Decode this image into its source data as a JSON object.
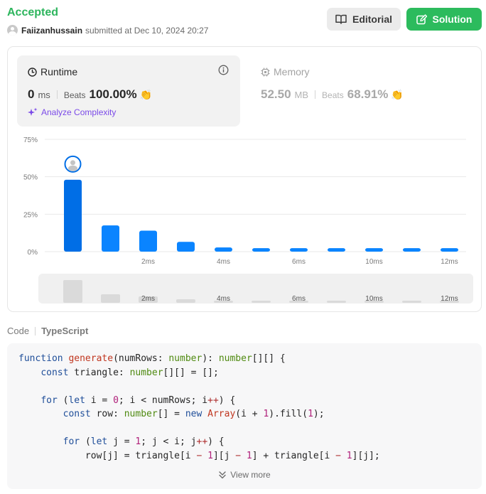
{
  "submission": {
    "status": "Accepted",
    "username": "Faiizanhussain",
    "submitted_text": "submitted at Dec 10, 2024 20:27"
  },
  "actions": {
    "editorial_label": "Editorial",
    "solution_label": "Solution"
  },
  "runtime": {
    "title": "Runtime",
    "value": "0",
    "unit": "ms",
    "beats_label": "Beats",
    "beats_value": "100.00%",
    "analyze_label": "Analyze Complexity"
  },
  "memory": {
    "title": "Memory",
    "value": "52.50",
    "unit": "MB",
    "beats_label": "Beats",
    "beats_value": "68.91%"
  },
  "chart_data": {
    "type": "bar",
    "y_ticks": [
      "75%",
      "50%",
      "25%",
      "0%"
    ],
    "ylim": [
      0,
      75
    ],
    "x_tick_labels": [
      "2ms",
      "4ms",
      "6ms",
      "10ms",
      "12ms"
    ],
    "values": [
      48,
      17.5,
      14,
      6.5,
      2.8,
      2.3,
      2.3,
      2.3,
      2.3,
      2.3,
      2.3
    ],
    "highlight_index": 0,
    "colors": {
      "selected": "#006ee6",
      "bar": "#0a84ff",
      "grid": "#e8e8e8",
      "mini_bar": "#dadada"
    },
    "mini_values": [
      32,
      12,
      9,
      5,
      3,
      3,
      3,
      3,
      3,
      3,
      3
    ]
  },
  "code": {
    "header_label": "Code",
    "language": "TypeScript",
    "view_more_label": "View more",
    "lines": [
      [
        [
          "kw",
          "function "
        ],
        [
          "fn",
          "generate"
        ],
        [
          "",
          "(numRows: "
        ],
        [
          "ty",
          "number"
        ],
        [
          "",
          "): "
        ],
        [
          "ty",
          "number"
        ],
        [
          "",
          "[][] {"
        ]
      ],
      [
        [
          "",
          "    "
        ],
        [
          "kw",
          "const "
        ],
        [
          "",
          "triangle: "
        ],
        [
          "ty",
          "number"
        ],
        [
          "",
          "[][] = [];"
        ]
      ],
      [
        [
          "",
          ""
        ]
      ],
      [
        [
          "",
          "    "
        ],
        [
          "kw",
          "for "
        ],
        [
          "",
          "("
        ],
        [
          "kw",
          "let "
        ],
        [
          "",
          "i = "
        ],
        [
          "num",
          "0"
        ],
        [
          "",
          "; i < numRows; i"
        ],
        [
          "op",
          "++"
        ],
        [
          "",
          ") {"
        ]
      ],
      [
        [
          "",
          "        "
        ],
        [
          "kw",
          "const "
        ],
        [
          "",
          "row: "
        ],
        [
          "ty",
          "number"
        ],
        [
          "",
          "[] = "
        ],
        [
          "kw",
          "new "
        ],
        [
          "fn",
          "Array"
        ],
        [
          "",
          "(i + "
        ],
        [
          "num",
          "1"
        ],
        [
          "",
          ").fill("
        ],
        [
          "num",
          "1"
        ],
        [
          "",
          ");"
        ]
      ],
      [
        [
          "",
          ""
        ]
      ],
      [
        [
          "",
          "        "
        ],
        [
          "kw",
          "for "
        ],
        [
          "",
          "("
        ],
        [
          "kw",
          "let "
        ],
        [
          "",
          "j = "
        ],
        [
          "num",
          "1"
        ],
        [
          "",
          "; j < i; j"
        ],
        [
          "op",
          "++"
        ],
        [
          "",
          ") {"
        ]
      ],
      [
        [
          "",
          "            row[j] = triangle[i "
        ],
        [
          "op",
          "−"
        ],
        [
          "num",
          " 1"
        ],
        [
          "",
          "][j "
        ],
        [
          "op",
          "−"
        ],
        [
          "num",
          " 1"
        ],
        [
          "",
          "] + triangle[i "
        ],
        [
          "op",
          "−"
        ],
        [
          "num",
          " 1"
        ],
        [
          "",
          "][j];"
        ]
      ]
    ]
  }
}
